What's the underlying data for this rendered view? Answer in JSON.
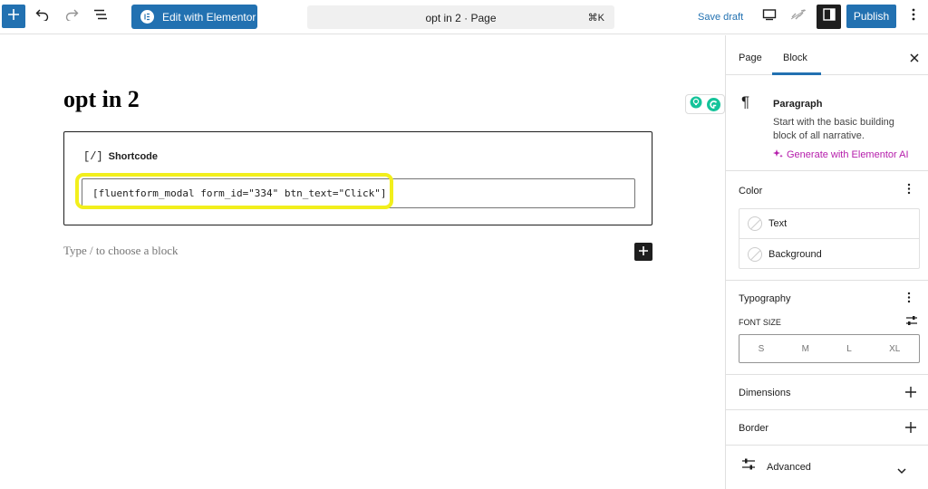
{
  "toolbar": {
    "add_block_icon": "plus-icon",
    "undo_icon": "undo-icon",
    "redo_icon": "redo-icon",
    "document_overview_icon": "list-view-icon",
    "elementor_label": "Edit with Elementor",
    "elementor_logo_letter": "E",
    "command_title": "opt in 2 · Page",
    "command_shortcut": "⌘K",
    "save_draft_label": "Save draft",
    "preview_icon": "desktop-icon",
    "view_icon": "view-link-icon",
    "settings_icon": "sidebar-toggle-icon",
    "publish_label": "Publish",
    "options_icon": "more-vertical-icon",
    "accent_color": "#2271b1"
  },
  "editor": {
    "page_title": "opt in 2",
    "shortcode_block": {
      "icon_glyph": "[/]",
      "label": "Shortcode",
      "value": "[fluentform_modal form_id=\"334\" btn_text=\"Click\"]",
      "highlight_color": "#f2ef1c"
    },
    "placeholder": "Type / to choose a block",
    "grammarly_icon": "grammarly-icon"
  },
  "sidebar": {
    "tabs": [
      "Page",
      "Block"
    ],
    "active_tab": "Block",
    "close_icon": "close-icon",
    "block_card": {
      "icon_glyph": "¶",
      "name": "Paragraph",
      "description": "Start with the basic building block of all narrative.",
      "ai_link": "Generate with Elementor AI",
      "ai_color": "#b51cab"
    },
    "color": {
      "title": "Color",
      "items": [
        "Text",
        "Background"
      ]
    },
    "typography": {
      "title": "Typography",
      "font_size_label": "FONT SIZE",
      "sizes": [
        "S",
        "M",
        "L",
        "XL"
      ]
    },
    "dimensions": {
      "title": "Dimensions"
    },
    "border": {
      "title": "Border"
    },
    "advanced": {
      "title": "Advanced"
    }
  }
}
